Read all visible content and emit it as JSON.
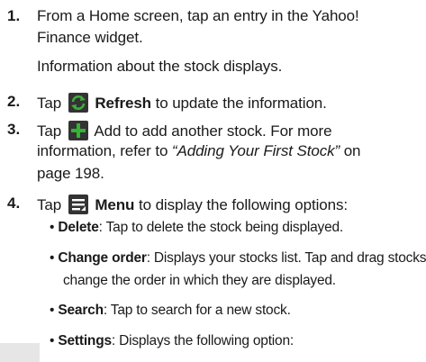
{
  "steps": {
    "s1": {
      "num": "1.",
      "line1": "From a Home screen, tap an entry in the Yahoo!",
      "line2": "Finance widget.",
      "line3": "Information about the stock displays."
    },
    "s2": {
      "num": "2.",
      "tap": "Tap",
      "icon": "refresh-icon",
      "label": "Refresh",
      "rest": "to update the information."
    },
    "s3": {
      "num": "3.",
      "tap": "Tap",
      "icon": "add-icon",
      "line1_rest": "Add to add another stock. For more",
      "line2_pre": "information, refer to ",
      "line2_ref": "“Adding Your First Stock”",
      "line2_post": " on",
      "line3": "page 198."
    },
    "s4": {
      "num": "4.",
      "tap": "Tap",
      "icon": "menu-icon",
      "label": "Menu",
      "rest": "to display the following options:",
      "bullets": [
        {
          "term": "Delete",
          "text": ": Tap to delete the stock being displayed."
        },
        {
          "term": "Change order",
          "text": ": Displays your stocks list. Tap and drag stocks to",
          "cont": "change the order in which they are displayed."
        },
        {
          "term": "Search",
          "text": ": Tap to search for a new stock."
        },
        {
          "term": "Settings",
          "text": ": Displays the following option:"
        }
      ]
    }
  },
  "colors": {
    "icon_bg": "#333333",
    "icon_fg": "#ffffff",
    "refresh_ring": "#3fae3a",
    "add_plus": "#35b335",
    "text": "#1a1a1a"
  }
}
